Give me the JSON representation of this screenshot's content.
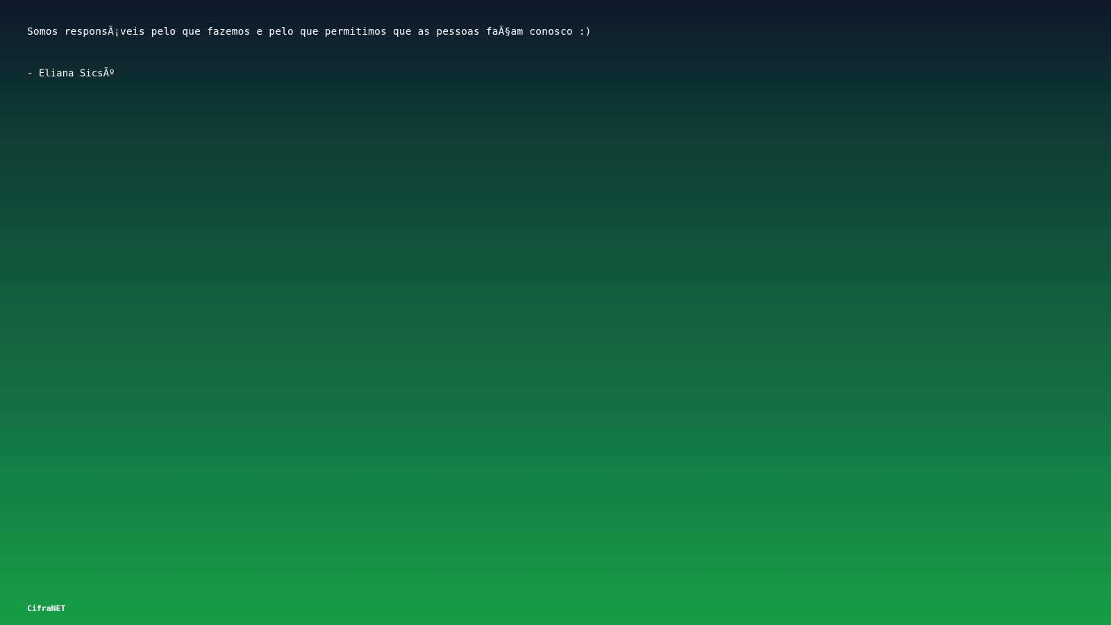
{
  "quote": {
    "text": "Somos responsÃ¡veis pelo que fazemos e pelo que permitimos que as pessoas faÃ§am conosco :)",
    "author": "- Eliana SicsÃº"
  },
  "footer": {
    "brand": "CifraNET"
  },
  "colors": {
    "gradient_top": "#0d182d",
    "gradient_bottom": "#169e48",
    "text": "#ffffff"
  }
}
